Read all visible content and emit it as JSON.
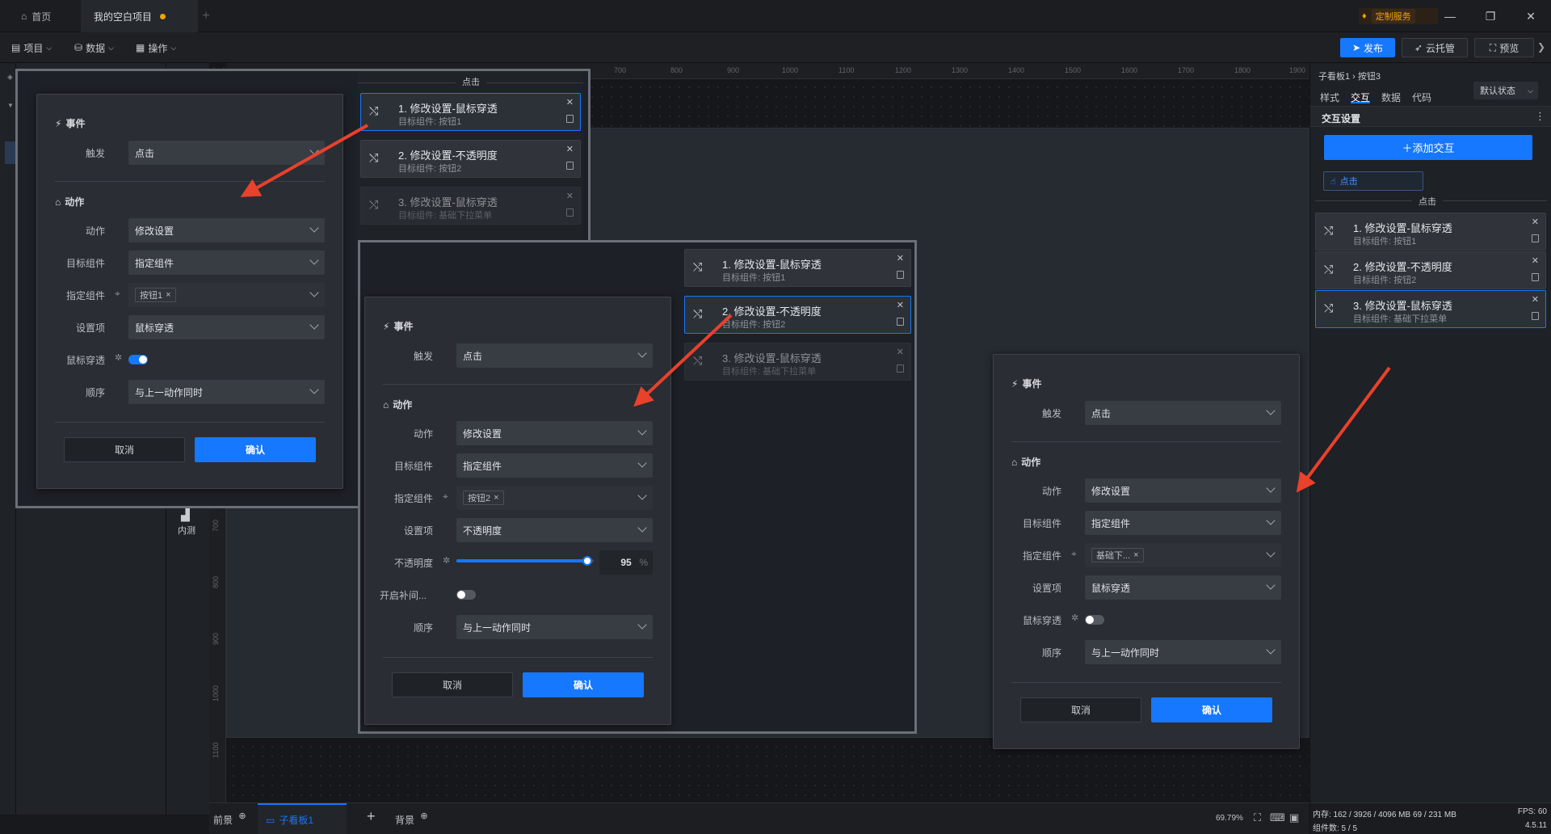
{
  "titlebar": {
    "home_tab": "首页",
    "project_tab": "我的空白项目",
    "custom_service": "定制服务"
  },
  "toolbar": {
    "project": "项目",
    "data": "数据",
    "operate": "操作",
    "publish": "发布",
    "cloud": "云托管",
    "preview": "预览"
  },
  "ruler": {
    "top": [
      "700",
      "800",
      "900",
      "1000",
      "1100",
      "1200",
      "1300",
      "1400",
      "1500",
      "1600",
      "1700",
      "1800",
      "1900"
    ],
    "left": [
      "700",
      "800",
      "900",
      "1000",
      "1100"
    ]
  },
  "iconcol": {
    "inner_test": "内测"
  },
  "bottombar": {
    "foreground": "前景",
    "subboard": "子看板1",
    "background": "背景",
    "zoom": "69.79%"
  },
  "right": {
    "breadcrumb": "子看板1 › 按钮3",
    "tabs": [
      "样式",
      "交互",
      "数据",
      "代码"
    ],
    "state": "默认状态",
    "section": "交互设置",
    "add": "＋添加交互",
    "trigger_tag": "点击",
    "group_label": "点击",
    "cards": [
      {
        "title": "1. 修改设置-鼠标穿透",
        "sub": "目标组件: 按钮1"
      },
      {
        "title": "2. 修改设置-不透明度",
        "sub": "目标组件: 按钮2"
      },
      {
        "title": "3. 修改设置-鼠标穿透",
        "sub": "目标组件: 基础下拉菜单"
      }
    ],
    "status": {
      "mem": "内存:  162 / 3926 / 4096 MB  69 / 231 MB",
      "fps": "FPS:  60",
      "count": "组件数: 5 / 5",
      "version": "4.5.11"
    }
  },
  "zoom1": {
    "group_label": "点击",
    "cards": [
      {
        "title": "1. 修改设置-鼠标穿透",
        "sub": "目标组件: 按钮1"
      },
      {
        "title": "2. 修改设置-不透明度",
        "sub": "目标组件: 按钮2"
      },
      {
        "title": "3. 修改设置-鼠标穿透",
        "sub": "目标组件: 基础下拉菜单"
      }
    ]
  },
  "zoom2": {
    "cards": [
      {
        "title": "1. 修改设置-鼠标穿透",
        "sub": "目标组件: 按钮1"
      },
      {
        "title": "2. 修改设置-不透明度",
        "sub": "目标组件: 按钮2"
      },
      {
        "title": "3. 修改设置-鼠标穿透",
        "sub": "目标组件: 基础下拉菜单"
      }
    ]
  },
  "dialog1": {
    "event": "事件",
    "trigger_label": "触发",
    "trigger": "点击",
    "action_sec": "动作",
    "action_label": "动作",
    "action": "修改设置",
    "target_label": "目标组件",
    "target": "指定组件",
    "specified_label": "指定组件",
    "specified_tag": "按钮1",
    "setting_label": "设置项",
    "setting": "鼠标穿透",
    "passthrough_label": "鼠标穿透",
    "order_label": "顺序",
    "order": "与上一动作同时",
    "cancel": "取消",
    "ok": "确认"
  },
  "dialog2": {
    "event": "事件",
    "trigger_label": "触发",
    "trigger": "点击",
    "action_sec": "动作",
    "action_label": "动作",
    "action": "修改设置",
    "target_label": "目标组件",
    "target": "指定组件",
    "specified_label": "指定组件",
    "specified_tag": "按钮2",
    "setting_label": "设置项",
    "setting": "不透明度",
    "opacity_label": "不透明度",
    "opacity_value": "95",
    "opacity_unit": "%",
    "tween_label": "开启补间...",
    "order_label": "顺序",
    "order": "与上一动作同时",
    "cancel": "取消",
    "ok": "确认"
  },
  "dialog3": {
    "event": "事件",
    "trigger_label": "触发",
    "trigger": "点击",
    "action_sec": "动作",
    "action_label": "动作",
    "action": "修改设置",
    "target_label": "目标组件",
    "target": "指定组件",
    "specified_label": "指定组件",
    "specified_tag": "基础下...",
    "setting_label": "设置项",
    "setting": "鼠标穿透",
    "passthrough_label": "鼠标穿透",
    "order_label": "顺序",
    "order": "与上一动作同时",
    "cancel": "取消",
    "ok": "确认"
  },
  "colors": {
    "accent": "#1677ff",
    "arrow": "#e8412c",
    "warning_dot": "#f0a500"
  }
}
